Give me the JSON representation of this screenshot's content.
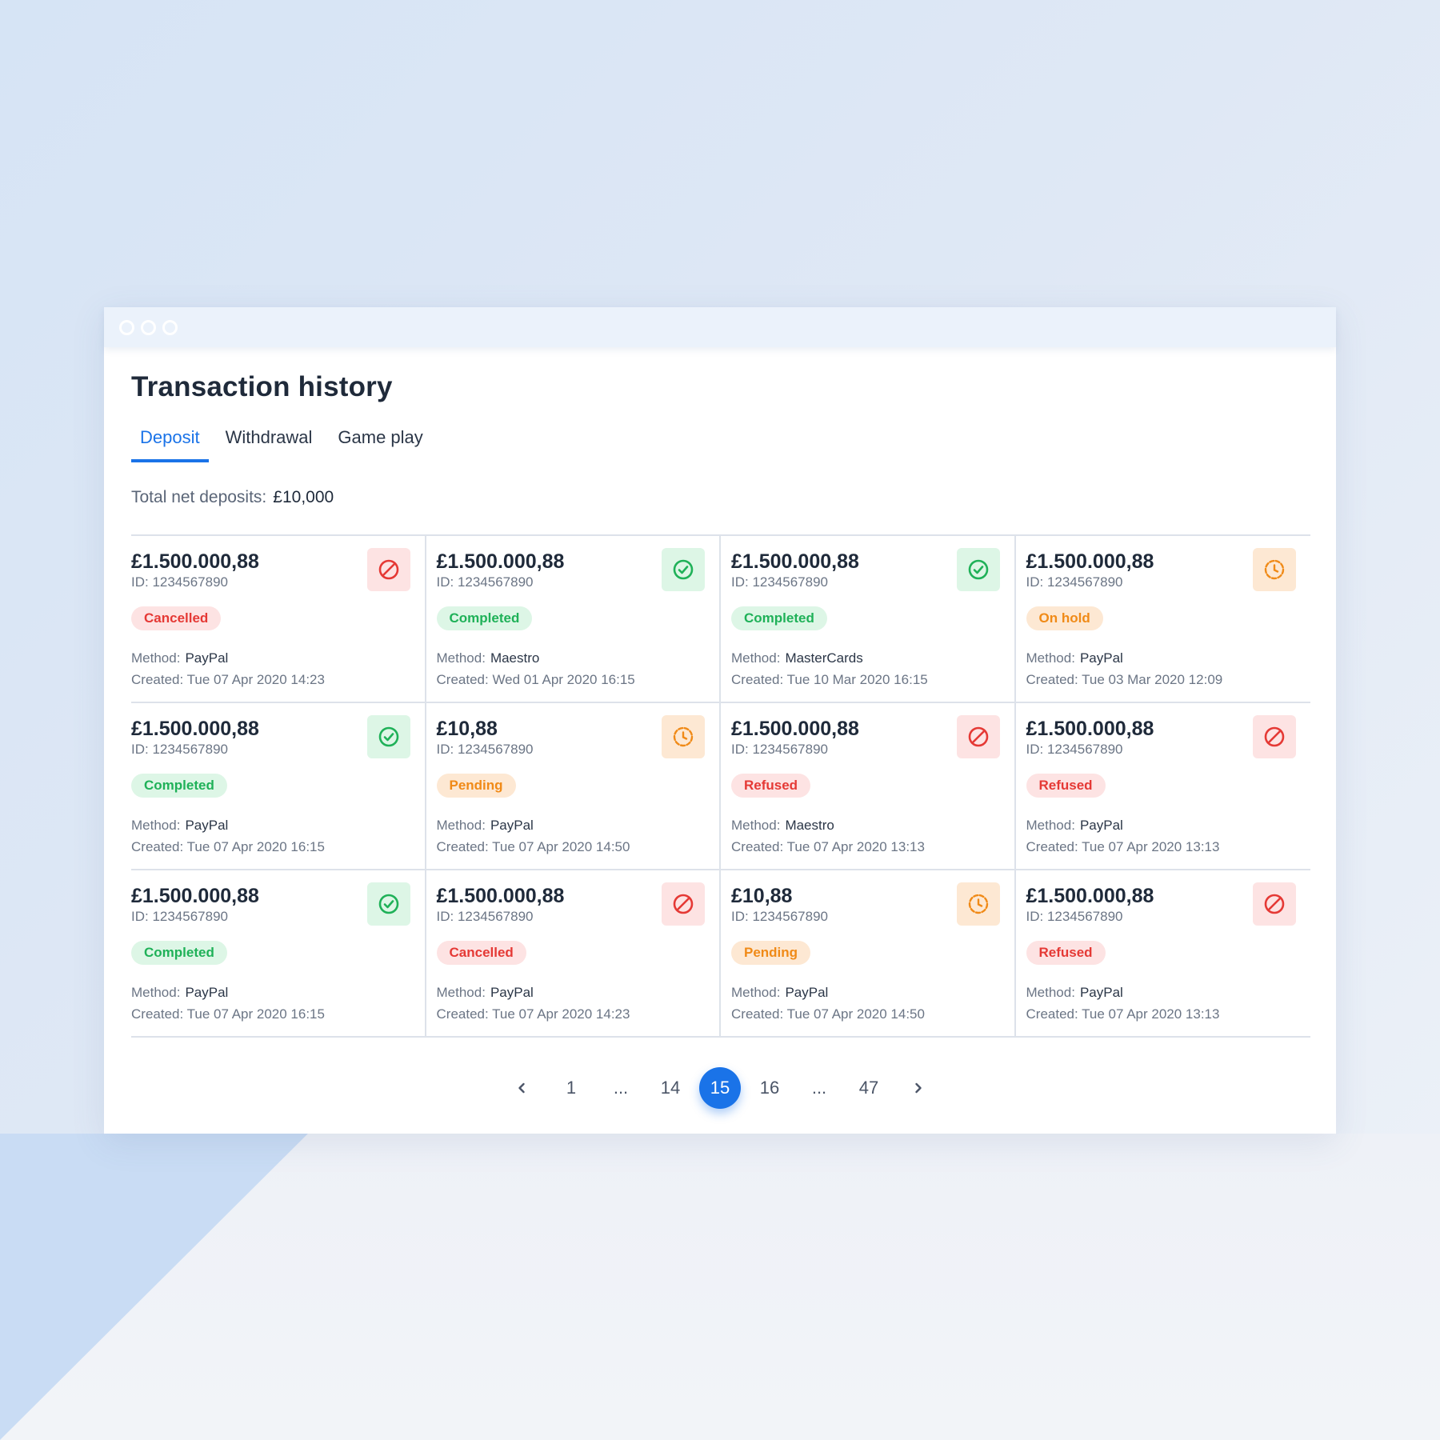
{
  "page_title": "Transaction history",
  "tabs": [
    {
      "label": "Deposit",
      "active": true
    },
    {
      "label": "Withdrawal",
      "active": false
    },
    {
      "label": "Game play",
      "active": false
    }
  ],
  "total": {
    "label": "Total net deposits:",
    "value": "£10,000"
  },
  "labels": {
    "method": "Method:",
    "created_prefix": "Created: "
  },
  "status_colors": {
    "cancelled": {
      "bg": "#fde3e3",
      "fg": "#e53935"
    },
    "refused": {
      "bg": "#fde3e3",
      "fg": "#e53935"
    },
    "completed": {
      "bg": "#ddf6e6",
      "fg": "#1fb158"
    },
    "pending": {
      "bg": "#fde8d3",
      "fg": "#f08a17"
    },
    "onhold": {
      "bg": "#fde8d3",
      "fg": "#f08a17"
    }
  },
  "accent_color": "#1a73e8",
  "transactions": [
    {
      "amount": "£1.500.000,88",
      "id": "ID: 1234567890",
      "status": "Cancelled",
      "status_key": "cancelled",
      "icon": "cancel-icon",
      "method": "PayPal",
      "created": "Tue 07 Apr 2020 14:23"
    },
    {
      "amount": "£1.500.000,88",
      "id": "ID: 1234567890",
      "status": "Completed",
      "status_key": "completed",
      "icon": "check-circle-icon",
      "method": "Maestro",
      "created": "Wed 01 Apr 2020 16:15"
    },
    {
      "amount": "£1.500.000,88",
      "id": "ID: 1234567890",
      "status": "Completed",
      "status_key": "completed",
      "icon": "check-circle-icon",
      "method": "MasterCards",
      "created": "Tue 10 Mar 2020 16:15"
    },
    {
      "amount": "£1.500.000,88",
      "id": "ID: 1234567890",
      "status": "On hold",
      "status_key": "onhold",
      "icon": "clock-icon",
      "method": "PayPal",
      "created": "Tue 03 Mar 2020 12:09"
    },
    {
      "amount": "£1.500.000,88",
      "id": "ID: 1234567890",
      "status": "Completed",
      "status_key": "completed",
      "icon": "check-circle-icon",
      "method": "PayPal",
      "created": "Tue 07 Apr 2020 16:15"
    },
    {
      "amount": "£10,88",
      "id": "ID: 1234567890",
      "status": "Pending",
      "status_key": "pending",
      "icon": "clock-icon",
      "method": "PayPal",
      "created": "Tue 07 Apr 2020 14:50"
    },
    {
      "amount": "£1.500.000,88",
      "id": "ID: 1234567890",
      "status": "Refused",
      "status_key": "refused",
      "icon": "cancel-icon",
      "method": "Maestro",
      "created": "Tue 07 Apr 2020 13:13"
    },
    {
      "amount": "£1.500.000,88",
      "id": "ID: 1234567890",
      "status": "Refused",
      "status_key": "refused",
      "icon": "cancel-icon",
      "method": "PayPal",
      "created": "Tue 07 Apr 2020 13:13"
    },
    {
      "amount": "£1.500.000,88",
      "id": "ID: 1234567890",
      "status": "Completed",
      "status_key": "completed",
      "icon": "check-circle-icon",
      "method": "PayPal",
      "created": "Tue 07 Apr 2020 16:15"
    },
    {
      "amount": "£1.500.000,88",
      "id": "ID: 1234567890",
      "status": "Cancelled",
      "status_key": "cancelled",
      "icon": "cancel-icon",
      "method": "PayPal",
      "created": "Tue 07 Apr 2020 14:23"
    },
    {
      "amount": "£10,88",
      "id": "ID: 1234567890",
      "status": "Pending",
      "status_key": "pending",
      "icon": "clock-icon",
      "method": "PayPal",
      "created": "Tue 07 Apr 2020 14:50"
    },
    {
      "amount": "£1.500.000,88",
      "id": "ID: 1234567890",
      "status": "Refused",
      "status_key": "refused",
      "icon": "cancel-icon",
      "method": "PayPal",
      "created": "Tue 07 Apr 2020 13:13"
    }
  ],
  "pagination": {
    "prev_icon": "chevron-left-icon",
    "next_icon": "chevron-right-icon",
    "items": [
      {
        "label": "1",
        "type": "page"
      },
      {
        "label": "...",
        "type": "ellipsis"
      },
      {
        "label": "14",
        "type": "page"
      },
      {
        "label": "15",
        "type": "current"
      },
      {
        "label": "16",
        "type": "page"
      },
      {
        "label": "...",
        "type": "ellipsis"
      },
      {
        "label": "47",
        "type": "page"
      }
    ]
  }
}
